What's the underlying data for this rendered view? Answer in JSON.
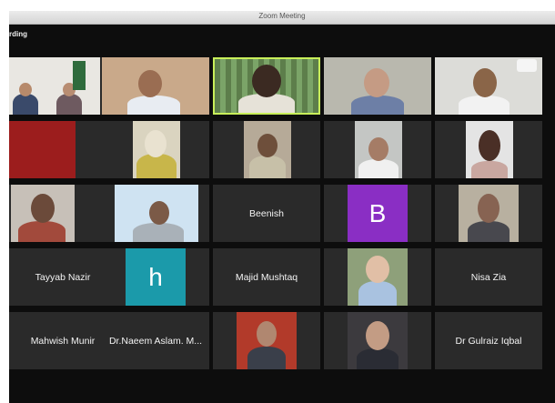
{
  "window": {
    "title": "Zoom Meeting",
    "recording_label": "rding"
  },
  "colors": {
    "tile_bg": "#2a2a2a",
    "active_speaker": "#c8ef5a",
    "avatar_b": "#8a2ec4",
    "avatar_h": "#1b9aaa"
  },
  "participants": [
    {
      "name": "Beenish",
      "type": "name"
    },
    {
      "initial": "B",
      "type": "avatar"
    },
    {
      "name": "Tayyab Nazir",
      "type": "name"
    },
    {
      "initial": "h",
      "type": "avatar"
    },
    {
      "name": "Majid Mushtaq",
      "type": "name"
    },
    {
      "name": "Nisa Zia",
      "type": "name"
    },
    {
      "name": "Mahwish Munir",
      "type": "name"
    },
    {
      "name": "Dr.Naeem Aslam. M...",
      "type": "name"
    },
    {
      "name": "Dr Gulraiz Iqbal",
      "type": "name"
    }
  ]
}
